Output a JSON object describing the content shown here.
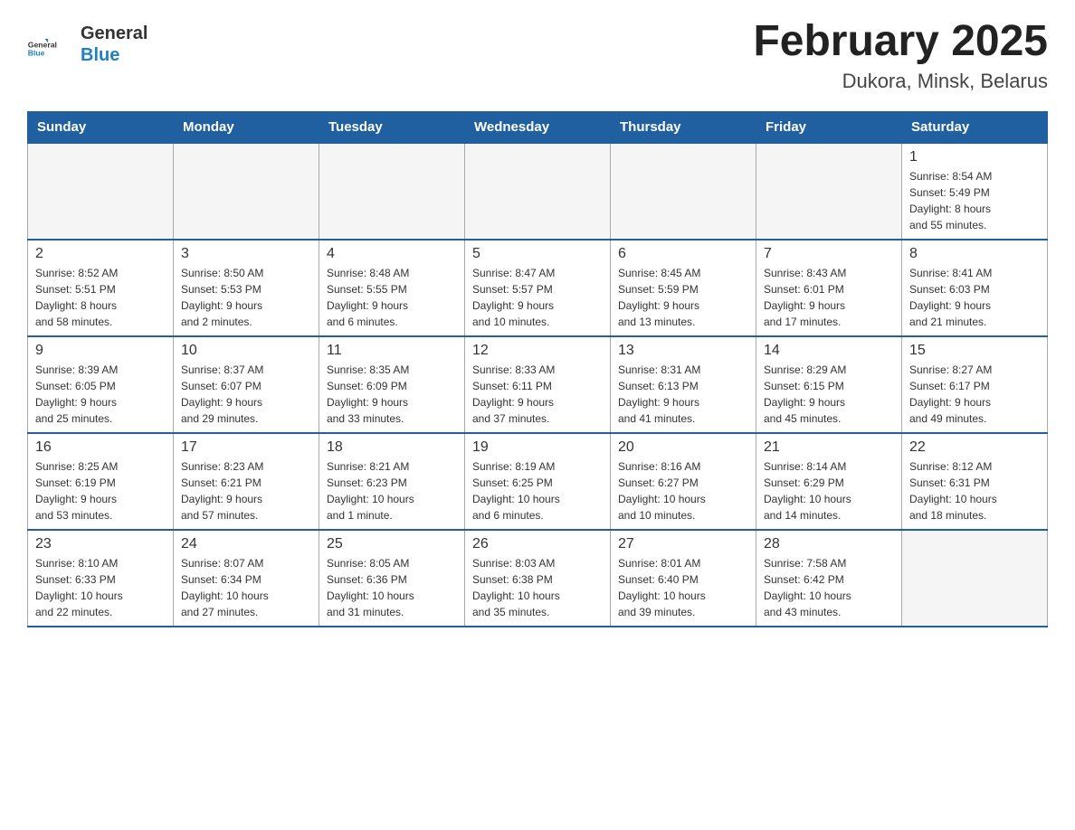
{
  "header": {
    "logo_top": "General",
    "logo_bottom": "Blue",
    "month_title": "February 2025",
    "location": "Dukora, Minsk, Belarus"
  },
  "days_of_week": [
    "Sunday",
    "Monday",
    "Tuesday",
    "Wednesday",
    "Thursday",
    "Friday",
    "Saturday"
  ],
  "weeks": [
    [
      {
        "day": "",
        "info": ""
      },
      {
        "day": "",
        "info": ""
      },
      {
        "day": "",
        "info": ""
      },
      {
        "day": "",
        "info": ""
      },
      {
        "day": "",
        "info": ""
      },
      {
        "day": "",
        "info": ""
      },
      {
        "day": "1",
        "info": "Sunrise: 8:54 AM\nSunset: 5:49 PM\nDaylight: 8 hours\nand 55 minutes."
      }
    ],
    [
      {
        "day": "2",
        "info": "Sunrise: 8:52 AM\nSunset: 5:51 PM\nDaylight: 8 hours\nand 58 minutes."
      },
      {
        "day": "3",
        "info": "Sunrise: 8:50 AM\nSunset: 5:53 PM\nDaylight: 9 hours\nand 2 minutes."
      },
      {
        "day": "4",
        "info": "Sunrise: 8:48 AM\nSunset: 5:55 PM\nDaylight: 9 hours\nand 6 minutes."
      },
      {
        "day": "5",
        "info": "Sunrise: 8:47 AM\nSunset: 5:57 PM\nDaylight: 9 hours\nand 10 minutes."
      },
      {
        "day": "6",
        "info": "Sunrise: 8:45 AM\nSunset: 5:59 PM\nDaylight: 9 hours\nand 13 minutes."
      },
      {
        "day": "7",
        "info": "Sunrise: 8:43 AM\nSunset: 6:01 PM\nDaylight: 9 hours\nand 17 minutes."
      },
      {
        "day": "8",
        "info": "Sunrise: 8:41 AM\nSunset: 6:03 PM\nDaylight: 9 hours\nand 21 minutes."
      }
    ],
    [
      {
        "day": "9",
        "info": "Sunrise: 8:39 AM\nSunset: 6:05 PM\nDaylight: 9 hours\nand 25 minutes."
      },
      {
        "day": "10",
        "info": "Sunrise: 8:37 AM\nSunset: 6:07 PM\nDaylight: 9 hours\nand 29 minutes."
      },
      {
        "day": "11",
        "info": "Sunrise: 8:35 AM\nSunset: 6:09 PM\nDaylight: 9 hours\nand 33 minutes."
      },
      {
        "day": "12",
        "info": "Sunrise: 8:33 AM\nSunset: 6:11 PM\nDaylight: 9 hours\nand 37 minutes."
      },
      {
        "day": "13",
        "info": "Sunrise: 8:31 AM\nSunset: 6:13 PM\nDaylight: 9 hours\nand 41 minutes."
      },
      {
        "day": "14",
        "info": "Sunrise: 8:29 AM\nSunset: 6:15 PM\nDaylight: 9 hours\nand 45 minutes."
      },
      {
        "day": "15",
        "info": "Sunrise: 8:27 AM\nSunset: 6:17 PM\nDaylight: 9 hours\nand 49 minutes."
      }
    ],
    [
      {
        "day": "16",
        "info": "Sunrise: 8:25 AM\nSunset: 6:19 PM\nDaylight: 9 hours\nand 53 minutes."
      },
      {
        "day": "17",
        "info": "Sunrise: 8:23 AM\nSunset: 6:21 PM\nDaylight: 9 hours\nand 57 minutes."
      },
      {
        "day": "18",
        "info": "Sunrise: 8:21 AM\nSunset: 6:23 PM\nDaylight: 10 hours\nand 1 minute."
      },
      {
        "day": "19",
        "info": "Sunrise: 8:19 AM\nSunset: 6:25 PM\nDaylight: 10 hours\nand 6 minutes."
      },
      {
        "day": "20",
        "info": "Sunrise: 8:16 AM\nSunset: 6:27 PM\nDaylight: 10 hours\nand 10 minutes."
      },
      {
        "day": "21",
        "info": "Sunrise: 8:14 AM\nSunset: 6:29 PM\nDaylight: 10 hours\nand 14 minutes."
      },
      {
        "day": "22",
        "info": "Sunrise: 8:12 AM\nSunset: 6:31 PM\nDaylight: 10 hours\nand 18 minutes."
      }
    ],
    [
      {
        "day": "23",
        "info": "Sunrise: 8:10 AM\nSunset: 6:33 PM\nDaylight: 10 hours\nand 22 minutes."
      },
      {
        "day": "24",
        "info": "Sunrise: 8:07 AM\nSunset: 6:34 PM\nDaylight: 10 hours\nand 27 minutes."
      },
      {
        "day": "25",
        "info": "Sunrise: 8:05 AM\nSunset: 6:36 PM\nDaylight: 10 hours\nand 31 minutes."
      },
      {
        "day": "26",
        "info": "Sunrise: 8:03 AM\nSunset: 6:38 PM\nDaylight: 10 hours\nand 35 minutes."
      },
      {
        "day": "27",
        "info": "Sunrise: 8:01 AM\nSunset: 6:40 PM\nDaylight: 10 hours\nand 39 minutes."
      },
      {
        "day": "28",
        "info": "Sunrise: 7:58 AM\nSunset: 6:42 PM\nDaylight: 10 hours\nand 43 minutes."
      },
      {
        "day": "",
        "info": ""
      }
    ]
  ]
}
